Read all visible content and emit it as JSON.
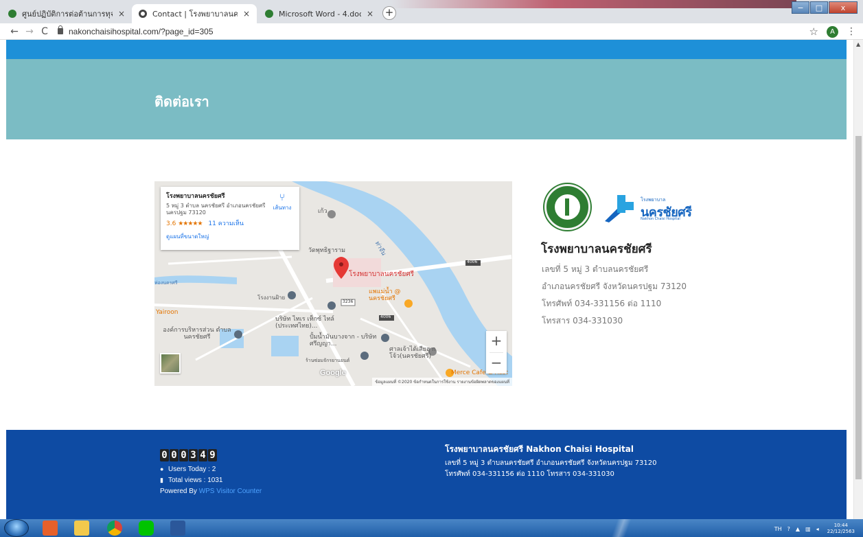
{
  "browser": {
    "tabs": [
      {
        "label": "ศูนย์ปฏิบัติการต่อต้านการทุจริต กระทรว",
        "close": "×",
        "active": false,
        "favicon_color": "#2e7d32"
      },
      {
        "label": "Contact | โรงพยาบาลนครชัยศรี",
        "close": "×",
        "active": true,
        "favicon_color": "#444444"
      },
      {
        "label": "Microsoft Word - 4.doc",
        "close": "×",
        "active": false,
        "favicon_color": "#2e7d32"
      }
    ],
    "new_tab": "+",
    "url": "nakonchaisihospital.com/?page_id=305",
    "profile_initial": "A",
    "back": "←",
    "forward": "→",
    "reload": "C",
    "bookmark": "☆",
    "menu": "⋮"
  },
  "hero": {
    "title": "ติดต่อเรา"
  },
  "map": {
    "place_name": "โรงพยาบาลนครชัยศรี",
    "address": "5 หมู่ 3 ตำบล นครชัยศรี อำเภอนครชัยศรี นครปฐม 73120",
    "rating": "3.6",
    "stars": "★★★★★",
    "reviews": "11 ความเห็น",
    "view_larger": "ดูแผนที่ขนาดใหญ่",
    "directions": "เส้นทาง",
    "pin_label": "โรงพยาบาลนครชัยศรี",
    "zoom_in": "+",
    "zoom_out": "−",
    "google": "Google",
    "attribution": "ข้อมูลแผนที่ ©2020  ข้อกำหนดในการใช้งาน  รายงานข้อผิดพลาดของแผนที่",
    "labels": {
      "chinese_temple_top": "เก้ว",
      "temple": "วัดพุทธิฐาราม",
      "river": "ท่าจีน",
      "road_4006_top": "4006",
      "road_4006_mid": "4006",
      "road_3236": "3236",
      "school": "โรงงานฝ้าย",
      "yairoon": "Yairoon",
      "market": "แพแม่น้ำ @ นครชัยศรี",
      "company": "บริษัท ไทเร เท็กซ์ ไทล์ (ประเทศไทย)...",
      "admin": "องค์การบริหารส่วน ตำบลนครชัยศรี",
      "gas": "ปั้มน้ำมันบางจาก - บริษัท ศรีญญา...",
      "shrine": "ศาลเจ้าไต้เสียฮุ กโจ้ว(นครชัยศรี)",
      "garage": "ร้านซ่อมจักรยานยนต์",
      "cafe": "Merce Cafe & Rest",
      "left_edge": "ห่องนครศรี"
    }
  },
  "contact": {
    "logo_small": "โรงพยาบาล",
    "logo_big": "นครชัยศรี",
    "logo_en": "Nakhon Chaisi Hospital",
    "title": "โรงพยาบาลนครชัยศรี",
    "lines": [
      "เลขที่ 5 หมู่ 3 ตำบลนครชัยศรี",
      "อำเภอนครชัยศรี จังหวัดนครปฐม 73120",
      "โทรศัพท์ 034-331156 ต่อ 1110",
      "โทรสาร 034-331030"
    ]
  },
  "footer": {
    "counter_digits": [
      "0",
      "0",
      "0",
      "3",
      "4",
      "9"
    ],
    "users_today": "Users Today : 2",
    "total_views": "Total views : 1031",
    "powered_by": "Powered By",
    "powered_link": "WPS Visitor Counter",
    "title": "โรงพยาบาลนครชัยศรี Nakhon Chaisi Hospital",
    "address_line1": "เลขที่ 5 หมู่ 3 ตำบลนครชัยศรี อำเภอนครชัยศรี จังหวัดนครปฐม 73120",
    "address_line2": "โทรศัพท์ 034-331156 ต่อ 1110 โทรสาร 034-331030"
  },
  "taskbar": {
    "lang": "TH",
    "time": "10:44",
    "date": "22/12/2563"
  },
  "colors": {
    "hero": "#7bbcc4",
    "top_strip": "#1e90d8",
    "footer": "#0e4ba3",
    "river": "#a9d3f2"
  }
}
